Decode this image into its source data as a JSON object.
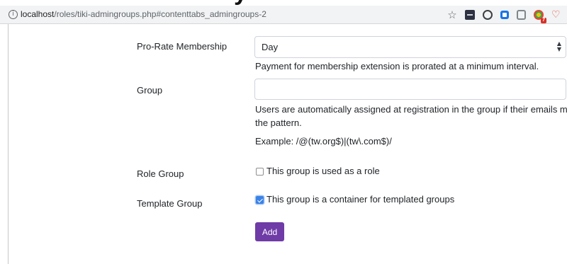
{
  "browser": {
    "url_host": "localhost",
    "url_path": "/roles/tiki-admingroups.php#contenttabs_admingroups-2",
    "star_glyph": "☆",
    "info_glyph": "i",
    "extension_badge": "7"
  },
  "form": {
    "prorate": {
      "label": "Pro-Rate Membership",
      "selected_value": "Day",
      "help": "Payment for membership extension is prorated at a minimum interval."
    },
    "group": {
      "label": "Group",
      "value": "",
      "help_line1": "Users are automatically assigned at registration in the group if their emails match",
      "help_line2": "the pattern.",
      "example": "Example: /@(tw.org$)|(tw\\.com$)/"
    },
    "role_group": {
      "label": "Role Group",
      "checkbox_label": "This group is used as a role",
      "checked": false
    },
    "template_group": {
      "label": "Template Group",
      "checkbox_label": "This group is a container for templated groups",
      "checked": true
    },
    "add_button_label": "Add"
  },
  "colors": {
    "primary_button": "#6f3ba6",
    "checkbox_checked": "#3b82e6"
  }
}
